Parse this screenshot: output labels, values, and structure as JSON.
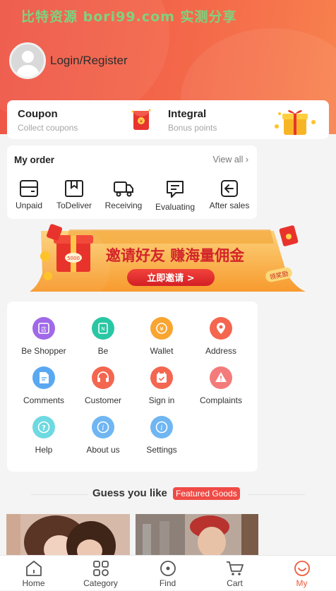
{
  "watermark": "比特资源 bori99.com 实测分享",
  "header": {
    "login_label": "Login/Register"
  },
  "cards": {
    "coupon": {
      "title": "Coupon",
      "subtitle": "Collect coupons"
    },
    "integral": {
      "title": "Integral",
      "subtitle": "Bonus points"
    }
  },
  "order": {
    "title": "My order",
    "view_all": "View all",
    "items": [
      {
        "label": "Unpaid",
        "icon": "wallet-card-icon"
      },
      {
        "label": "ToDeliver",
        "icon": "box-icon"
      },
      {
        "label": "Receiving",
        "icon": "truck-icon"
      },
      {
        "label": "Evaluating",
        "icon": "comment-icon"
      },
      {
        "label": "After sales",
        "icon": "return-icon"
      }
    ]
  },
  "banner": {
    "headline": "邀请好友 赚海量佣金",
    "button": "立即邀请 >",
    "tag": "领奖励",
    "box_label": "5000"
  },
  "services": [
    {
      "label": "Be Shopper",
      "icon": "shop-icon",
      "color": "#a069e8"
    },
    {
      "label": "Be",
      "icon": "store-icon",
      "color": "#29c7a3"
    },
    {
      "label": "Wallet",
      "icon": "yen-coin-icon",
      "color": "#f9a530"
    },
    {
      "label": "Address",
      "icon": "location-pin-icon",
      "color": "#f4664f"
    },
    {
      "label": "Comments",
      "icon": "document-icon",
      "color": "#5aa8f2"
    },
    {
      "label": "Customer",
      "icon": "headset-icon",
      "color": "#f4664f"
    },
    {
      "label": "Sign in",
      "icon": "calendar-check-icon",
      "color": "#f4664f"
    },
    {
      "label": "Complaints",
      "icon": "warning-icon",
      "color": "#f47b7b"
    },
    {
      "label": "Help",
      "icon": "question-icon",
      "color": "#6ed9e0"
    },
    {
      "label": "About us",
      "icon": "info-icon",
      "color": "#6fb6f2"
    },
    {
      "label": "Settings",
      "icon": "info-icon",
      "color": "#6fb6f2"
    }
  ],
  "guess": {
    "title": "Guess you like",
    "badge": "Featured Goods"
  },
  "tabs": [
    {
      "label": "Home",
      "icon": "home-icon"
    },
    {
      "label": "Category",
      "icon": "category-icon"
    },
    {
      "label": "Find",
      "icon": "compass-icon"
    },
    {
      "label": "Cart",
      "icon": "cart-icon"
    },
    {
      "label": "My",
      "icon": "smile-icon",
      "active": true
    }
  ],
  "colors": {
    "accent": "#f05a3a",
    "header_start": "#ee5546",
    "header_end": "#f8824e"
  }
}
